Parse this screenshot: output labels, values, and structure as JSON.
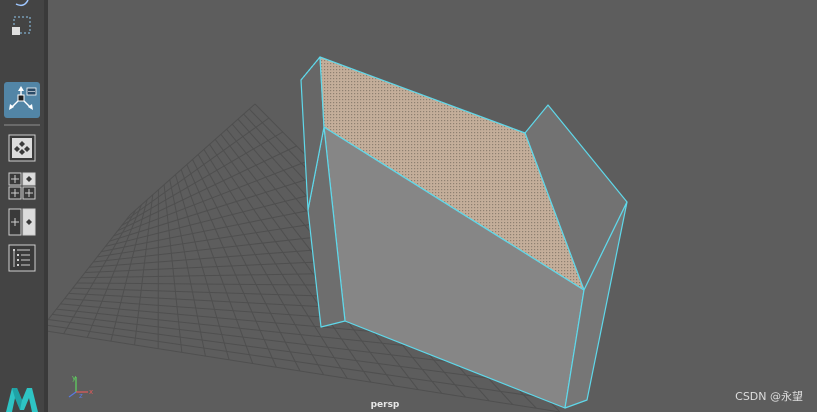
{
  "viewport": {
    "camera_label": "persp",
    "watermark": "CSDN @永望"
  },
  "toolbox": {
    "tools": [
      {
        "name": "select-icon"
      },
      {
        "name": "marquee-select-icon"
      },
      {
        "name": "manipulator-icon",
        "active": true
      },
      {
        "name": "single-perspective-layout-icon"
      },
      {
        "name": "four-view-layout-icon"
      },
      {
        "name": "two-pane-layout-icon"
      },
      {
        "name": "outliner-layout-icon"
      }
    ]
  },
  "colors": {
    "toolbox_bg": "#444444",
    "viewport_bg": "#5d5d5d",
    "grid_line": "#4e4e4e",
    "mesh_face": "#8a8a8a",
    "mesh_wire": "#5fd8ea",
    "selected_face": "#c0ac98",
    "active_tool": "#5285a6",
    "maya_logo": "#2ec4c4"
  }
}
